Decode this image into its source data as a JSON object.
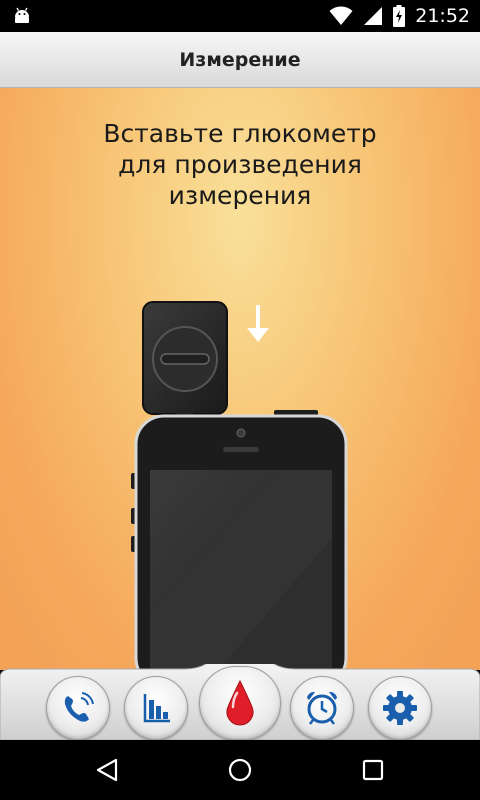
{
  "status_bar": {
    "time": "21:52",
    "icons": [
      "android-notification-icon",
      "wifi-icon",
      "signal-icon",
      "battery-charging-icon"
    ]
  },
  "header": {
    "title": "Измерение"
  },
  "content": {
    "instruction_lines": [
      "Вставьте глюкометр",
      "для произведения",
      "измерения"
    ]
  },
  "bottom_nav": {
    "buttons": [
      "call-icon",
      "statistics-icon",
      "blood-drop-icon",
      "alarm-clock-icon",
      "settings-gear-icon"
    ],
    "active": "blood-drop-icon"
  },
  "system_nav": [
    "back-icon",
    "home-icon",
    "recents-icon"
  ],
  "colors": {
    "accent_blue": "#1a5fae",
    "blood_red": "#e01e2a",
    "background_light": "#f9e09a",
    "background_dark": "#f4a155"
  }
}
